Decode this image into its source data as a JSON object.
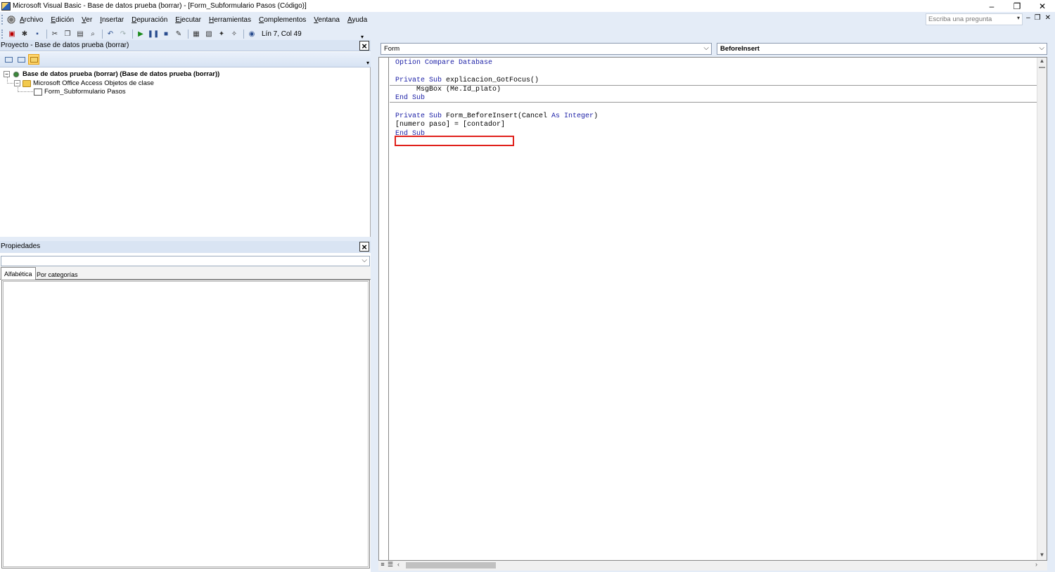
{
  "window": {
    "title": "Microsoft Visual Basic - Base de datos prueba (borrar) - [Form_Subformulario Pasos (Código)]",
    "controls": {
      "minimize": "–",
      "restore": "❐",
      "close": "✕"
    }
  },
  "menu": {
    "items": [
      "Archivo",
      "Edición",
      "Ver",
      "Insertar",
      "Depuración",
      "Ejecutar",
      "Herramientas",
      "Complementos",
      "Ventana",
      "Ayuda"
    ],
    "ask_placeholder": "Escriba una pregunta",
    "mdi_controls": {
      "minimize": "–",
      "restore": "❐",
      "close": "✕"
    }
  },
  "toolbar": {
    "position_text": "Lín 7, Col 49"
  },
  "project_explorer": {
    "title": "Proyecto - Base de datos prueba (borrar)",
    "tree": {
      "root": "Base de datos prueba (borrar) (Base de datos prueba (borrar))",
      "folder": "Microsoft Office Access Objetos de clase",
      "item": "Form_Subformulario Pasos"
    }
  },
  "properties": {
    "title": "Propiedades",
    "tabs": [
      "Alfabética",
      "Por categorías"
    ]
  },
  "code_window": {
    "object_combo": "Form",
    "procedure_combo": "BeforeInsert",
    "highlight_color": "#e0201b",
    "keyword_color": "#1b1fa6"
  }
}
